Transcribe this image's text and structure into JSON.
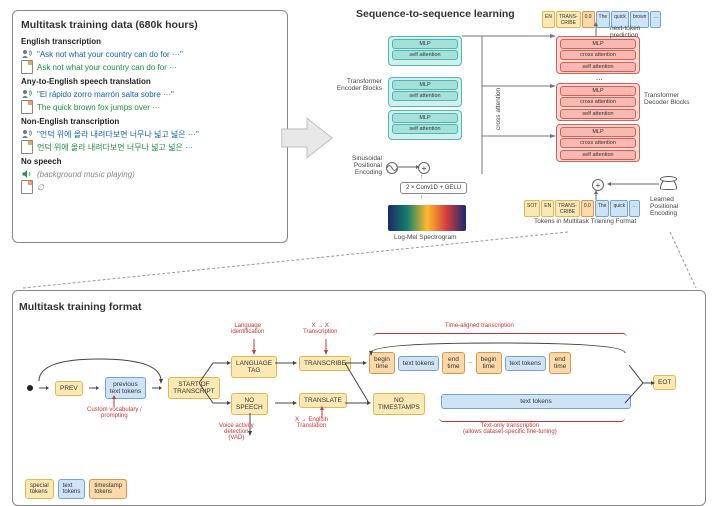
{
  "multitask": {
    "title": "Multitask training data (680k hours)",
    "sections": [
      {
        "head": "English transcription",
        "audio": "\"Ask not what your country can do for ···\"",
        "out": "Ask not what your country can do for ···",
        "outClass": "green",
        "icon": "speak"
      },
      {
        "head": "Any-to-English speech translation",
        "audio": "\"El rápido zorro marrón salta sobre ···\"",
        "out": "The quick brown fox jumps over ···",
        "outClass": "green",
        "icon": "speak"
      },
      {
        "head": "Non-English transcription",
        "audio": "\"언덕 위에 올라 내려다보면 너무나 넓고 넓은 ···\"",
        "out": "언덕 위에 올라 내려다보면 너무나 넓고 넓은 ···",
        "outClass": "green",
        "icon": "speak"
      },
      {
        "head": "No speech",
        "audio": "(background music playing)",
        "out": "∅",
        "outClass": "grey",
        "icon": "sound"
      }
    ]
  },
  "seq": {
    "title": "Sequence-to-sequence learning",
    "encoder_label": "Transformer\nEncoder Blocks",
    "decoder_label": "Transformer\nDecoder Blocks",
    "cross_attention": "cross attention",
    "layers": {
      "mlp": "MLP",
      "sa": "self attention",
      "ca": "cross attention"
    },
    "sin_label": "Sinusoidal\nPositional\nEncoding",
    "conv": "2 × Conv1D + GELU",
    "spectro_cap": "Log-Mel Spectrogram",
    "learned_label": "Learned\nPositional\nEncoding",
    "next_token": "next-token\nprediction",
    "tokens_cap": "Tokens in Multitask Training Format",
    "top_tokens": [
      "EN",
      "TRANS-\nCRIBE",
      "0.0",
      "The",
      "quick",
      "brown",
      "…"
    ],
    "bot_tokens": [
      "SOT",
      "EN",
      "TRANS-\nCRIBE",
      "0.0",
      "The",
      "quick",
      "…"
    ]
  },
  "fmt": {
    "title": "Multitask training format",
    "prev": "PREV",
    "prev_tok": "previous\ntext tokens",
    "sot": "START OF\nTRANSCRIPT",
    "lang": "LANGUAGE\nTAG",
    "nosp": "NO\nSPEECH",
    "transcribe": "TRANSCRIBE",
    "translate": "TRANSLATE",
    "begin": "begin\ntime",
    "end": "end\ntime",
    "text": "text tokens",
    "nots": "NO\nTIMESTAMPS",
    "eot": "EOT",
    "ann": {
      "custom": "Custom vocabulary /\nprompting",
      "vad": "Voice activity\ndetection\n(VAD)",
      "langid": "Language\nidentification",
      "xx": "X → X\nTranscription",
      "xe": "X → English\nTranslation",
      "ta": "Time-aligned transcription",
      "to": "Text-only transcription\n(allows dataset-specific fine-tuning)"
    },
    "legend": {
      "special": "special\ntokens",
      "text": "text\ntokens",
      "ts": "timestamp\ntokens"
    }
  }
}
